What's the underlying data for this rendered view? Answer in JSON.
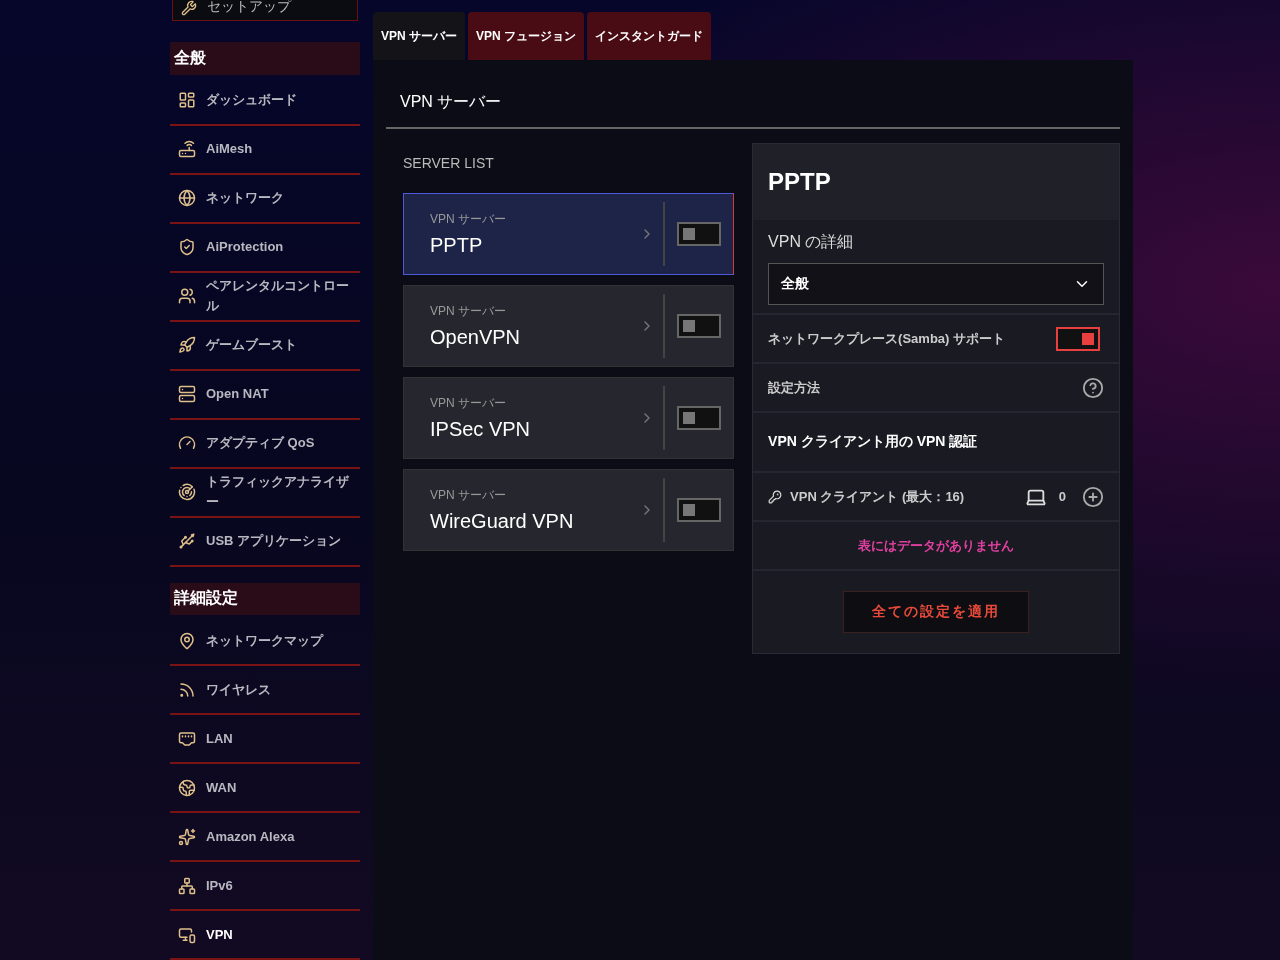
{
  "sidebar": {
    "setup_button": "セットアップ",
    "sections": [
      {
        "title": "全般",
        "items": [
          {
            "label": "ダッシュボード",
            "selected": false
          },
          {
            "label": "AiMesh",
            "selected": false
          },
          {
            "label": "ネットワーク",
            "selected": false
          },
          {
            "label": "AiProtection",
            "selected": false
          },
          {
            "label": "ペアレンタルコントロール",
            "selected": false
          },
          {
            "label": "ゲームブースト",
            "selected": false
          },
          {
            "label": "Open NAT",
            "selected": false
          },
          {
            "label": "アダプティブ QoS",
            "selected": false
          },
          {
            "label": "トラフィックアナライザー",
            "selected": false
          },
          {
            "label": "USB アプリケーション",
            "selected": false
          }
        ]
      },
      {
        "title": "詳細設定",
        "items": [
          {
            "label": "ネットワークマップ",
            "selected": false
          },
          {
            "label": "ワイヤレス",
            "selected": false
          },
          {
            "label": "LAN",
            "selected": false
          },
          {
            "label": "WAN",
            "selected": false
          },
          {
            "label": "Amazon Alexa",
            "selected": false
          },
          {
            "label": "IPv6",
            "selected": false
          },
          {
            "label": "VPN",
            "selected": true
          }
        ]
      }
    ]
  },
  "tabs": [
    {
      "label": "VPN サーバー",
      "selected": true
    },
    {
      "label": "VPN フュージョン",
      "selected": false
    },
    {
      "label": "インスタントガード",
      "selected": false
    }
  ],
  "page_title": "VPN サーバー",
  "server_list": {
    "heading": "SERVER LIST",
    "servers": [
      {
        "caption": "VPN サーバー",
        "name": "PPTP",
        "selected": true,
        "on": false
      },
      {
        "caption": "VPN サーバー",
        "name": "OpenVPN",
        "selected": false,
        "on": false
      },
      {
        "caption": "VPN サーバー",
        "name": "IPSec VPN",
        "selected": false,
        "on": false
      },
      {
        "caption": "VPN サーバー",
        "name": "WireGuard VPN",
        "selected": false,
        "on": false
      }
    ]
  },
  "detail": {
    "title": "PPTP",
    "details_label": "VPN の詳細",
    "details_value": "全般",
    "samba_label": "ネットワークプレース(Samba) サポート",
    "samba_on": true,
    "howto_label": "設定方法",
    "auth_heading": "VPN クライアント用の VPN 認証",
    "clients_label": "VPN クライアント (最大：16)",
    "clients_count": "0",
    "empty_message": "表にはデータがありません",
    "apply_button": "全ての設定を適用"
  }
}
